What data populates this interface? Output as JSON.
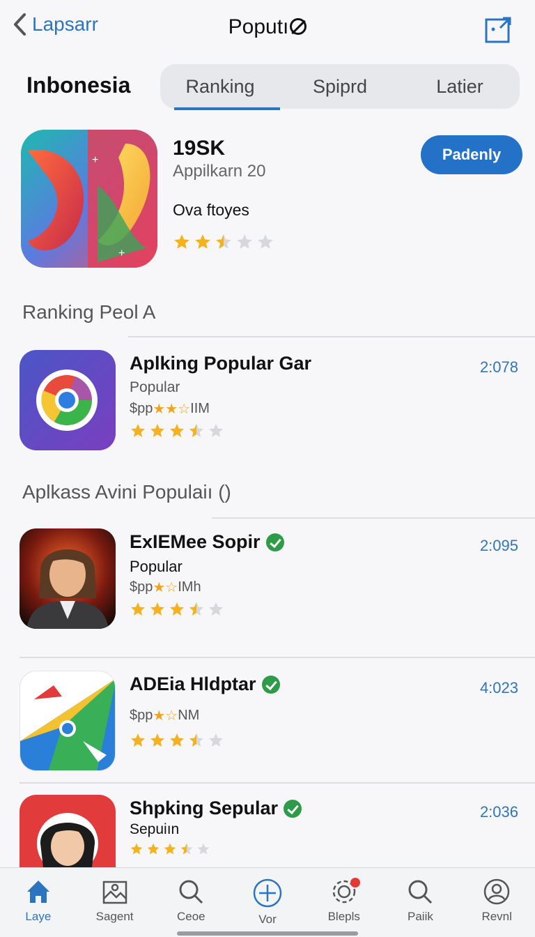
{
  "nav": {
    "back_label": "Lapsarr",
    "title": "Poputı",
    "title_icon": "no-entry-icon",
    "share_icon": "share-icon"
  },
  "region": "Inbonesia",
  "segments": [
    {
      "label": "Ranking",
      "active": true
    },
    {
      "label": "Spiprd",
      "active": false
    },
    {
      "label": "Latier",
      "active": false
    }
  ],
  "featured": {
    "title": "19SK",
    "subtitle": "Appilkarn 20",
    "description": "Ova ftoyes",
    "rating": 2.5,
    "rating_max": 5,
    "button_label": "Padenly"
  },
  "sections": {
    "first": "Ranking Peol A",
    "second": "Aplkass Avini Populaiı ()"
  },
  "rows": [
    {
      "title": "Aplking Popular Gar",
      "verified": false,
      "category": "Popular",
      "price_prefix": "$pp",
      "price_stars": "★★☆",
      "price_suffix": "IIM",
      "rating": 3.5,
      "time": "2:078",
      "icon": "chrome-like-icon"
    },
    {
      "title": "ExIEMee Sopir",
      "verified": true,
      "category": "Popular",
      "price_prefix": "$pp",
      "price_stars": "★☆",
      "price_suffix": "IMh",
      "rating": 3.5,
      "time": "2:095",
      "icon": "portrait-icon"
    },
    {
      "title": "ADEia Hldptar",
      "verified": true,
      "category": "",
      "price_prefix": "$pp",
      "price_stars": "★☆",
      "price_suffix": "NM",
      "rating": 3.5,
      "time": "4:023",
      "icon": "paper-plane-icon"
    },
    {
      "title": "Shpking Sepular",
      "verified": true,
      "category": "Sepuiın",
      "price_prefix": "",
      "price_stars": "",
      "price_suffix": "",
      "rating": 3.5,
      "time": "2:036",
      "icon": "woman-avatar-icon"
    }
  ],
  "tabs": [
    {
      "label": "Laye",
      "icon": "home-icon",
      "active": true
    },
    {
      "label": "Sagent",
      "icon": "image-icon",
      "active": false
    },
    {
      "label": "Ceoe",
      "icon": "search-icon",
      "active": false
    },
    {
      "label": "Vor",
      "icon": "plus-circle-icon",
      "active": false
    },
    {
      "label": "Blepls",
      "icon": "gear-icon",
      "active": false,
      "notification": true
    },
    {
      "label": "Paiik",
      "icon": "search-icon",
      "active": false
    },
    {
      "label": "Revnl",
      "icon": "user-icon",
      "active": false
    }
  ],
  "colors": {
    "accent": "#2a74c0",
    "button": "#2472c8",
    "star": "#f4b21f",
    "star_empty": "#d7d8dc",
    "verified": "#2e9b48"
  }
}
